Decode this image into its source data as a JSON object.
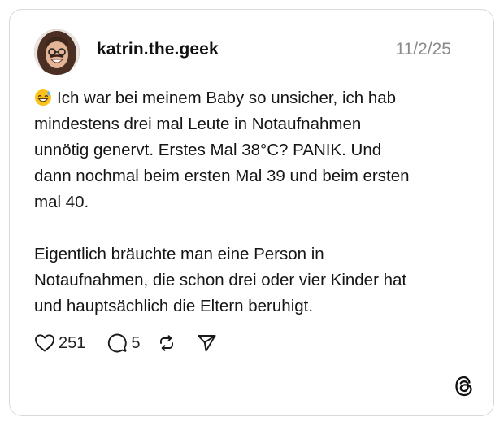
{
  "post": {
    "username": "katrin.the.geek",
    "date": "11/2/25",
    "paragraphs": [
      "Ich war bei meinem Baby so unsicher, ich hab\nmindestens drei mal Leute in Notaufnahmen\nunnötig genervt. Erstes Mal 38°C? PANIK. Und\ndann nochmal beim ersten Mal 39 und beim ersten\nmal 40.",
      "Eigentlich bräuchte man eine Person in\nNotaufnahmen, die schon drei oder vier Kinder hat\nund hauptsächlich die Eltern beruhigt."
    ],
    "emoji": "grinning-face-with-sweat-icon"
  },
  "actions": {
    "likes": "251",
    "replies": "5"
  },
  "icons": {
    "like": "heart-icon",
    "reply": "speech-bubble-icon",
    "repost": "repost-icon",
    "share": "send-icon",
    "brand": "threads-logo-icon"
  },
  "colors": {
    "border": "#d9d9d9",
    "text": "#151515",
    "muted": "#8a8a8a",
    "emoji_face": "#fcc21b",
    "sweat_drop": "#6db7e8"
  }
}
